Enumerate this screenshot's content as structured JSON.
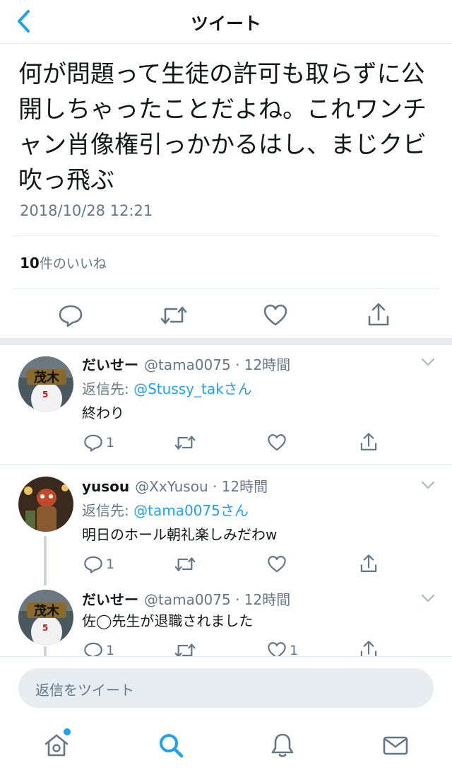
{
  "header": {
    "title": "ツイート"
  },
  "tweet": {
    "text": "何が問題って生徒の許可も取らずに公開しちゃったことだよね。これワンチャン肖像権引っかかるはし、まじクビ吹っ飛ぶ",
    "timestamp": "2018/10/28 12:21",
    "likes_count": "10",
    "likes_label": "件のいいね"
  },
  "replies": [
    {
      "name": "だいせー",
      "handle": "@tama0075 · 12時間",
      "reply_to_label": "返信先: ",
      "reply_to": "@Stussy_takさん",
      "text": "終わり",
      "reply_count": "1",
      "retweet_count": "",
      "like_count": ""
    },
    {
      "name": "yusou",
      "handle": "@XxYusou · 12時間",
      "reply_to_label": "返信先: ",
      "reply_to": "@tama0075さん",
      "text": "明日のホール朝礼楽しみだわw",
      "reply_count": "1",
      "retweet_count": "",
      "like_count": ""
    },
    {
      "name": "だいせー",
      "handle": "@tama0075 · 12時間",
      "text": "佐◯先生が退職されました",
      "reply_count": "1",
      "retweet_count": "",
      "like_count": "1"
    }
  ],
  "compose": {
    "placeholder": "返信をツイート"
  },
  "icons": {
    "back": "chevron-left-icon",
    "reply": "speech-bubble-icon",
    "retweet": "retweet-icon",
    "like": "heart-icon",
    "share": "share-icon",
    "home": "home-icon",
    "search": "search-icon",
    "notifications": "bell-icon",
    "messages": "envelope-icon"
  },
  "colors": {
    "accent": "#1da1f2",
    "muted": "#657786",
    "text": "#14171a",
    "separator": "#e6ecf0"
  },
  "tabs": {
    "active": "search"
  }
}
